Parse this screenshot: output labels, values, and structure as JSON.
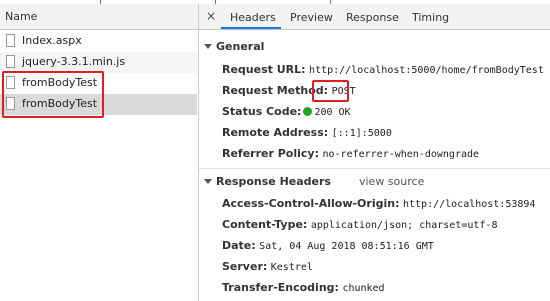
{
  "left": {
    "header": "Name",
    "requests": [
      {
        "name": "Index.aspx"
      },
      {
        "name": "jquery-3.3.1.min.js"
      },
      {
        "name": "fromBodyTest"
      },
      {
        "name": "fromBodyTest"
      }
    ]
  },
  "tabs": {
    "close": "×",
    "items": [
      "Headers",
      "Preview",
      "Response",
      "Timing"
    ],
    "active": "Headers"
  },
  "general": {
    "title": "General",
    "request_url_k": "Request URL:",
    "request_url_v": "http://localhost:5000/home/fromBodyTest",
    "request_method_k": "Request Method:",
    "request_method_v": "POST",
    "status_code_k": "Status Code:",
    "status_code_v": "200 OK",
    "remote_address_k": "Remote Address:",
    "remote_address_v": "[::1]:5000",
    "referrer_policy_k": "Referrer Policy:",
    "referrer_policy_v": "no-referrer-when-downgrade"
  },
  "response_headers": {
    "title": "Response Headers",
    "view_source": "view source",
    "acao_k": "Access-Control-Allow-Origin:",
    "acao_v": "http://localhost:53894",
    "content_type_k": "Content-Type:",
    "content_type_v": "application/json; charset=utf-8",
    "date_k": "Date:",
    "date_v": "Sat, 04 Aug 2018 08:51:16 GMT",
    "server_k": "Server:",
    "server_v": "Kestrel",
    "transfer_encoding_k": "Transfer-Encoding:",
    "transfer_encoding_v": "chunked"
  },
  "colors": {
    "highlight": "#e02020",
    "status_ok": "#1fa51f",
    "tab_active": "#1a73e8"
  }
}
